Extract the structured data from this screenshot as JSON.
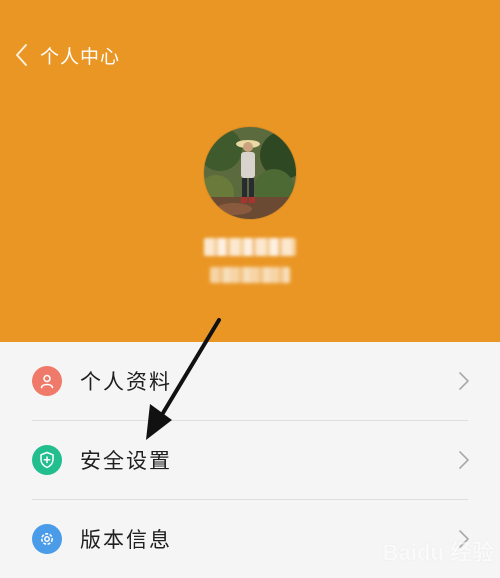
{
  "header": {
    "title": "个人中心",
    "back_icon": "chevron-left-icon",
    "background_color": "#ea9624"
  },
  "profile": {
    "avatar_icon": "user-photo"
  },
  "menu": {
    "items": [
      {
        "label": "个人资料",
        "icon": "user-icon",
        "icon_color": "#f07a69"
      },
      {
        "label": "安全设置",
        "icon": "shield-icon",
        "icon_color": "#22be8e"
      },
      {
        "label": "版本信息",
        "icon": "gear-icon",
        "icon_color": "#4a9be8"
      }
    ]
  },
  "watermark": {
    "text": "Baidu 经验"
  }
}
